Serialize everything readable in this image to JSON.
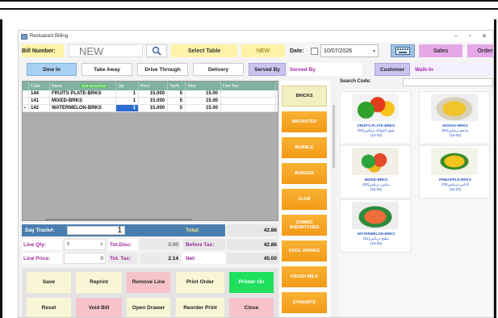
{
  "window": {
    "title": "Restuarant Billing"
  },
  "header": {
    "bill_label": "Bill Number:",
    "bill_value": "NEW",
    "select_table": "Select Table",
    "status": "NEW",
    "date_label": "Date:",
    "date_value": "10/07/2026",
    "sales": "Sales",
    "order": "Order"
  },
  "order_types": {
    "dine_in": "Dine In",
    "take_away": "Take Away",
    "drive_through": "Drive Through",
    "delivery": "Delivery"
  },
  "served_by": {
    "button": "Served By",
    "value": "Served By"
  },
  "customer": {
    "button": "Customer",
    "value": "Walk-In"
  },
  "grid": {
    "headers": [
      "Code",
      "Name",
      "Sub Items/Text",
      "Qty",
      "Price",
      "Tax%",
      "Total",
      "Line Text"
    ],
    "rows": [
      {
        "code": "144",
        "name": "FRUITS PLATE-BRKS",
        "qty": "1",
        "price": "15.000",
        "tax": "5",
        "total": "15.00"
      },
      {
        "code": "141",
        "name": "MIXED-BRKS",
        "qty": "1",
        "price": "15.000",
        "tax": "5",
        "total": "15.00"
      },
      {
        "code": "142",
        "name": "WATERMELON-BRKS",
        "qty": "1",
        "price": "15.000",
        "tax": "5",
        "total": "15.00"
      }
    ]
  },
  "summary": {
    "day_track_label": "Day Track#:",
    "day_track_value": "1",
    "total_label": "Total:",
    "total_value": "42.86",
    "line_qty_label": "Line Qty:",
    "line_qty_value": "0",
    "tot_disc_label": "Tot.Disc:",
    "tot_disc_value": "0.00",
    "before_tax_label": "Before Tax:",
    "before_tax_value": "42.86",
    "line_price_label": "Line Price:",
    "line_price_value": "0",
    "tot_tax_label": "Tot. Tax:",
    "tot_tax_value": "2.14",
    "net_label": "Net:",
    "net_value": "45.00"
  },
  "actions": {
    "save": "Save",
    "reprint": "Reprint",
    "remove_line": "Remove Line",
    "print_order": "Print Order",
    "printer_on": "Printer On",
    "reset": "Reset",
    "void_bill": "Void Bill",
    "open_drawer": "Open Drawer",
    "reorder_print": "Reorder Print",
    "close": "Close"
  },
  "categories": [
    "BRICKS",
    "BROASTED",
    "BUBBLE",
    "BURGER",
    "CLUB",
    "COMBO SNDWITCHES",
    "COOL DRINKS",
    "CRUSH MILK",
    "DYNAMITE"
  ],
  "search": {
    "label": "Search Code:",
    "placeholder": ""
  },
  "items": [
    {
      "name": "FRUITS PLATE-BRKS",
      "arabic": "(82)طبق الفواكه-بريكس",
      "price": "(15.00)"
    },
    {
      "name": "MANGO-BRKS",
      "arabic": "(82)مانجو-بريكس",
      "price": "(15.00)"
    },
    {
      "name": "MIXED-BRKS",
      "arabic": "(80)مكس-بريكس",
      "price": "(15.00)"
    },
    {
      "name": "PINEAPPLE-BRKS",
      "arabic": "(79)أناناس-بريكس",
      "price": "(15.00)"
    },
    {
      "name": "WATERMELON-BRKS",
      "arabic": "(81)بطيخ-بريكس",
      "price": "(15.00)"
    }
  ],
  "colors": {
    "accent_blue": "#4a7eb0",
    "category_orange": "#f29a16",
    "printer_on_green": "#1ee05c",
    "purple_text": "#a02a9c"
  }
}
